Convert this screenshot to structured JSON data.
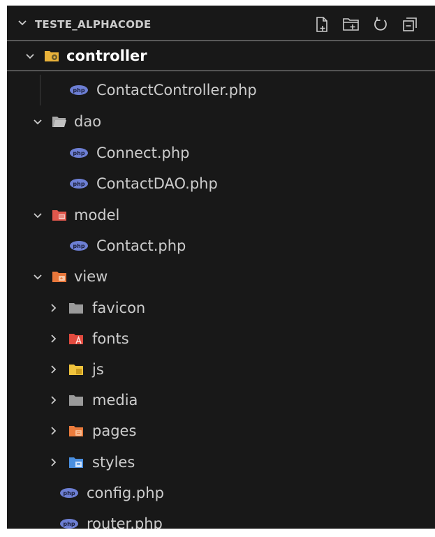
{
  "explorer": {
    "title": "TESTE_ALPHACODE",
    "actions": [
      {
        "name": "new-file-icon"
      },
      {
        "name": "new-folder-icon"
      },
      {
        "name": "refresh-icon"
      },
      {
        "name": "collapse-all-icon"
      }
    ]
  },
  "tree": {
    "controller": "controller",
    "contact_controller": "ContactController.php",
    "dao": "dao",
    "connect": "Connect.php",
    "contact_dao": "ContactDAO.php",
    "model": "model",
    "contact": "Contact.php",
    "view": "view",
    "favicon": "favicon",
    "fonts": "fonts",
    "js": "js",
    "media": "media",
    "pages": "pages",
    "styles": "styles",
    "config": "config.php",
    "router": "router.php"
  },
  "php_badge": "php",
  "colors": {
    "background": "#181818",
    "text": "#cccccc",
    "php": "#6d7fd4",
    "controller_folder": "#e9b23a",
    "model_folder": "#e0574c",
    "view_folder": "#e8773b",
    "fonts_folder": "#e24a3e",
    "js_folder": "#f0c33c",
    "pages_folder": "#ea7b3c",
    "styles_folder": "#4a8fe0",
    "plain_folder": "#9a9a9a"
  }
}
